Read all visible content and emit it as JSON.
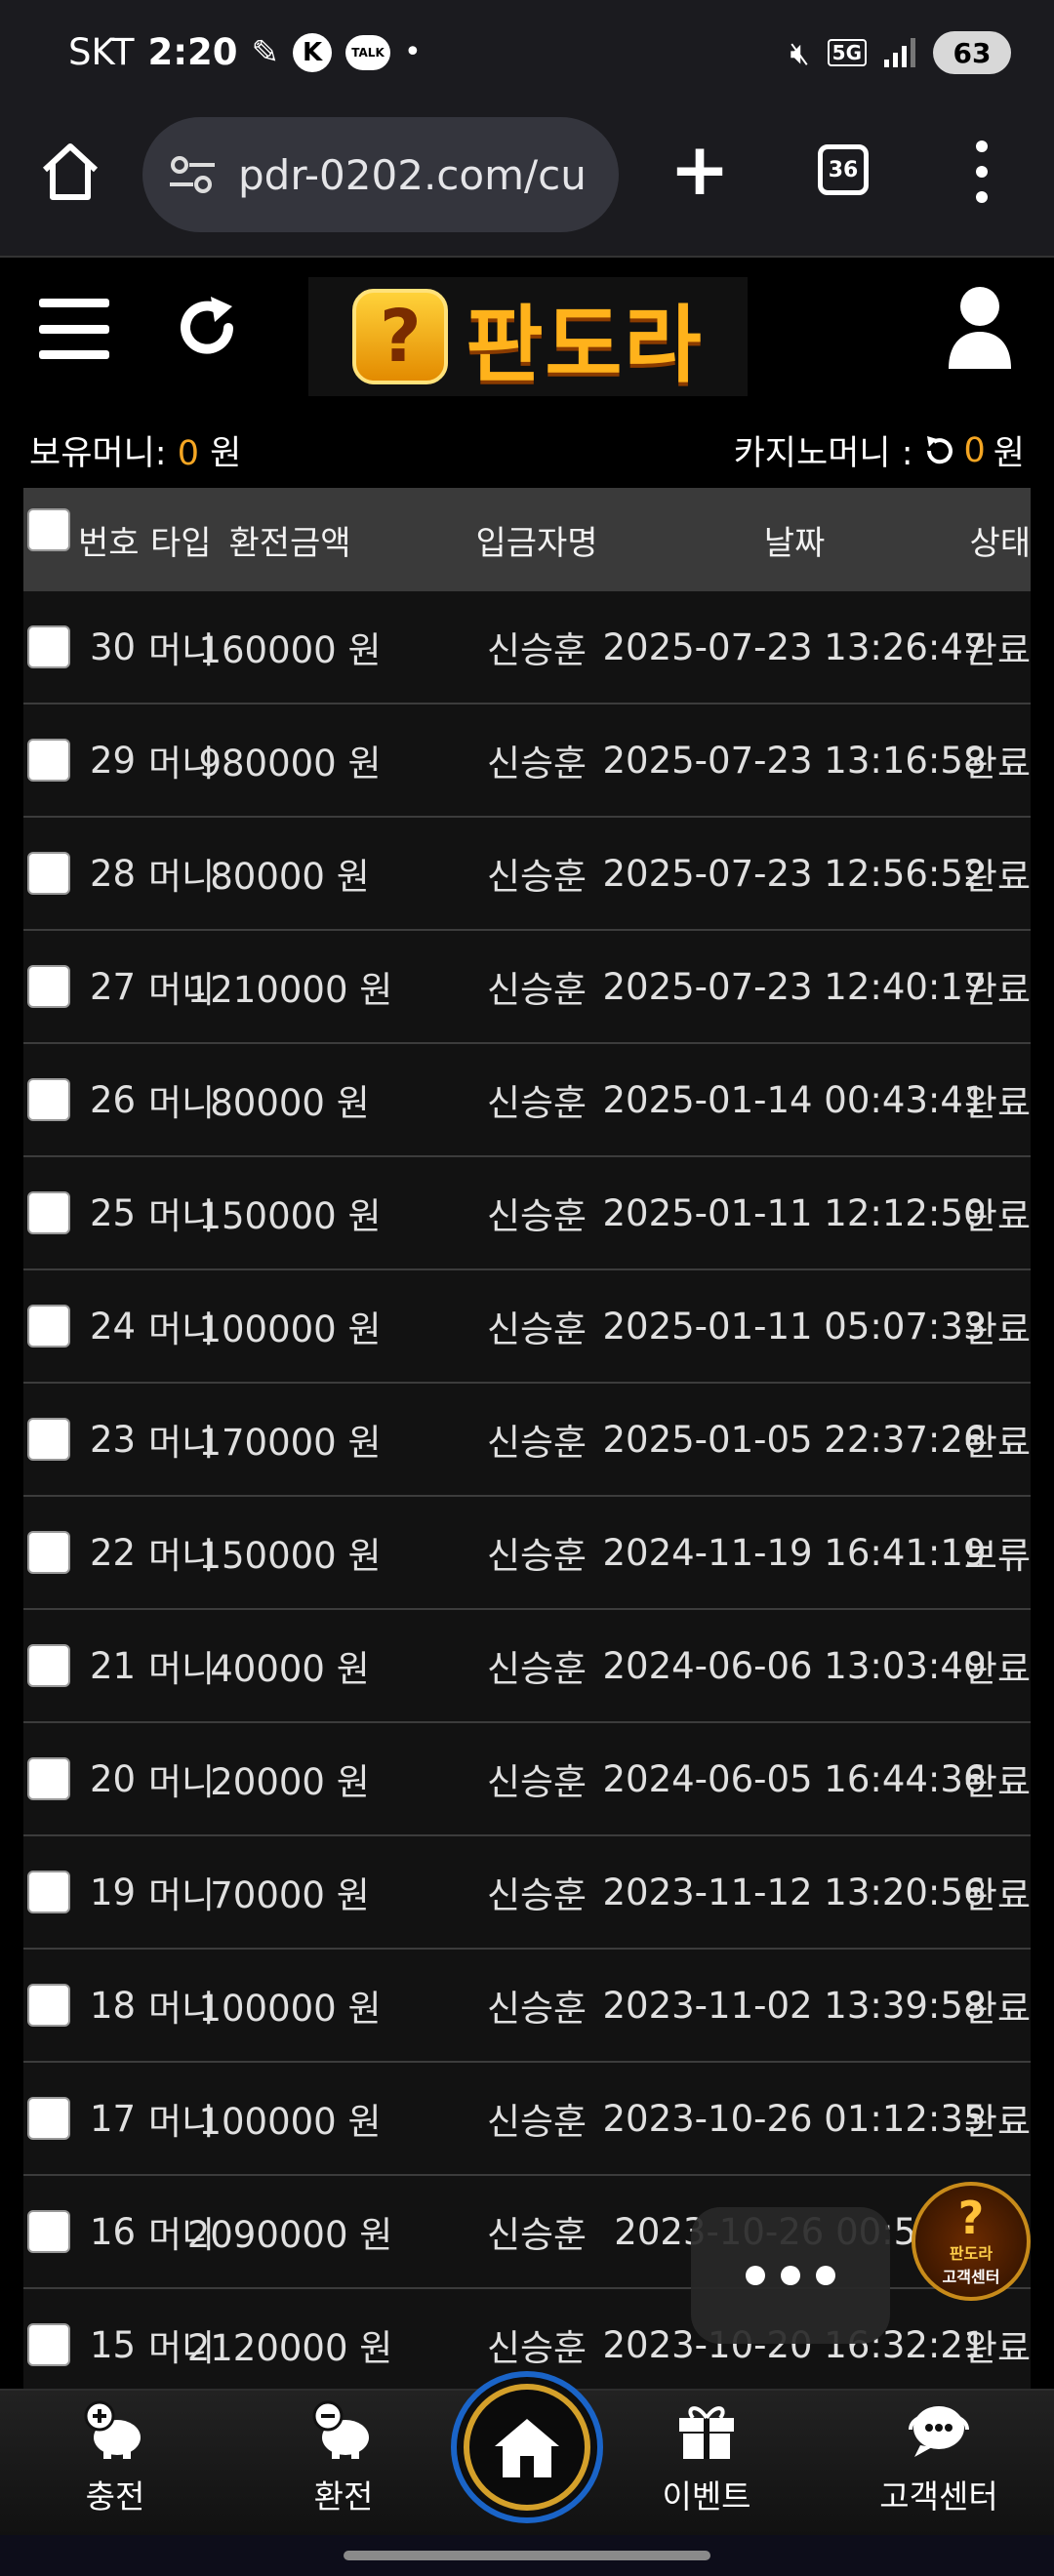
{
  "status_bar": {
    "carrier": "SKT",
    "time": "2:20",
    "network": "5G",
    "battery": "63"
  },
  "browser": {
    "url": "pdr-0202.com/cu",
    "tab_count": "36"
  },
  "site": {
    "logo_text": "판도라"
  },
  "balance": {
    "money_label": "보유머니:",
    "money_value": "0",
    "money_unit": "원",
    "casino_label": "카지노머니 :",
    "casino_value": "0",
    "casino_unit": "원"
  },
  "table": {
    "headers": {
      "no": "번호",
      "type": "타입",
      "amount": "환전금액",
      "name": "입금자명",
      "date": "날짜",
      "status": "상태"
    },
    "rows": [
      {
        "no": "30",
        "type": "머니",
        "amount": "160000 원",
        "name": "신승훈",
        "date": "2025-07-23 13:26:47",
        "status": "완료"
      },
      {
        "no": "29",
        "type": "머니",
        "amount": "980000 원",
        "name": "신승훈",
        "date": "2025-07-23 13:16:58",
        "status": "완료"
      },
      {
        "no": "28",
        "type": "머니",
        "amount": "80000 원",
        "name": "신승훈",
        "date": "2025-07-23 12:56:52",
        "status": "완료"
      },
      {
        "no": "27",
        "type": "머니",
        "amount": "1210000 원",
        "name": "신승훈",
        "date": "2025-07-23 12:40:17",
        "status": "완료"
      },
      {
        "no": "26",
        "type": "머니",
        "amount": "80000 원",
        "name": "신승훈",
        "date": "2025-01-14 00:43:41",
        "status": "완료"
      },
      {
        "no": "25",
        "type": "머니",
        "amount": "150000 원",
        "name": "신승훈",
        "date": "2025-01-11 12:12:50",
        "status": "완료"
      },
      {
        "no": "24",
        "type": "머니",
        "amount": "100000 원",
        "name": "신승훈",
        "date": "2025-01-11 05:07:33",
        "status": "완료"
      },
      {
        "no": "23",
        "type": "머니",
        "amount": "170000 원",
        "name": "신승훈",
        "date": "2025-01-05 22:37:26",
        "status": "완료"
      },
      {
        "no": "22",
        "type": "머니",
        "amount": "150000 원",
        "name": "신승훈",
        "date": "2024-11-19 16:41:19",
        "status": "보류"
      },
      {
        "no": "21",
        "type": "머니",
        "amount": "40000 원",
        "name": "신승훈",
        "date": "2024-06-06 13:03:40",
        "status": "완료"
      },
      {
        "no": "20",
        "type": "머니",
        "amount": "20000 원",
        "name": "신승훈",
        "date": "2024-06-05 16:44:36",
        "status": "완료"
      },
      {
        "no": "19",
        "type": "머니",
        "amount": "70000 원",
        "name": "신승훈",
        "date": "2023-11-12 13:20:56",
        "status": "완료"
      },
      {
        "no": "18",
        "type": "머니",
        "amount": "100000 원",
        "name": "신승훈",
        "date": "2023-11-02 13:39:58",
        "status": "완료"
      },
      {
        "no": "17",
        "type": "머니",
        "amount": "100000 원",
        "name": "신승훈",
        "date": "2023-10-26 01:12:35",
        "status": "완료"
      },
      {
        "no": "16",
        "type": "머니",
        "amount": "2090000 원",
        "name": "신승훈",
        "date": "2023-10-26 00:51:1",
        "status": ""
      },
      {
        "no": "15",
        "type": "머니",
        "amount": "2120000 원",
        "name": "신승훈",
        "date": "2023-10-20 16:32:21",
        "status": "완료"
      }
    ]
  },
  "floating": {
    "cs_badge_line1": "판도라",
    "cs_badge_line2": "고객센터"
  },
  "bottom_nav": {
    "charge": "충전",
    "exchange": "환전",
    "event": "이벤트",
    "support": "고객센터"
  }
}
